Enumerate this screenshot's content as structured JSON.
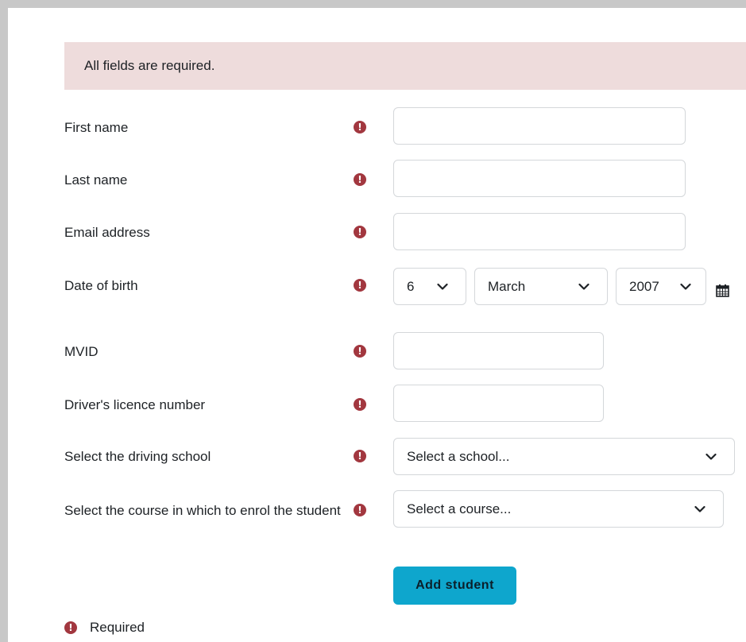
{
  "alert": {
    "message": "All fields are required."
  },
  "fields": {
    "first_name": {
      "label": "First name",
      "value": ""
    },
    "last_name": {
      "label": "Last name",
      "value": ""
    },
    "email": {
      "label": "Email address",
      "value": ""
    },
    "dob": {
      "label": "Date of birth",
      "day": "6",
      "month": "March",
      "year": "2007",
      "calendar_icon": "calendar-icon"
    },
    "mvid": {
      "label": "MVID",
      "value": ""
    },
    "licence": {
      "label": "Driver's licence number",
      "value": ""
    },
    "school": {
      "label": "Select the driving school",
      "selected": "Select a school..."
    },
    "course": {
      "label": "Select the course in which to enrol the student",
      "selected": "Select a course..."
    }
  },
  "actions": {
    "add_student_label": "Add student"
  },
  "legend": {
    "required_label": "Required"
  },
  "colors": {
    "alert_bg": "#eedcdc",
    "required_icon": "#a2373f",
    "button_bg": "#0ea6cd"
  }
}
